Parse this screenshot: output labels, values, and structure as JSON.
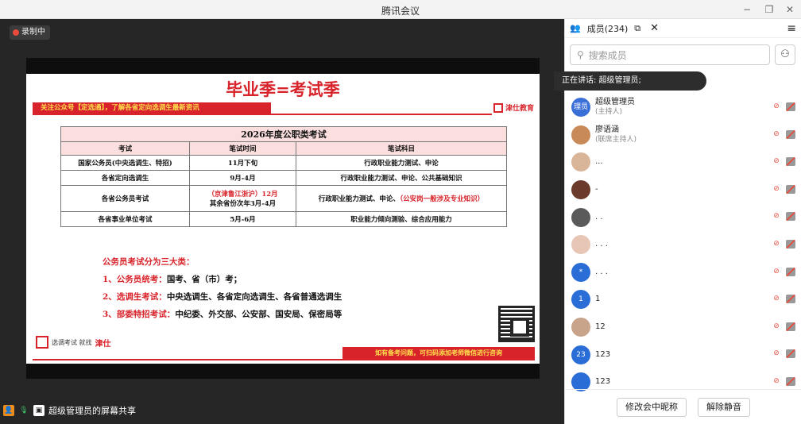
{
  "window": {
    "title": "腾讯会议",
    "min": "−",
    "restore": "❐",
    "close": "✕"
  },
  "stage": {
    "recording_label": "录制中",
    "share_label": "超级管理员的屏幕共享"
  },
  "slide": {
    "title": "毕业季=考试季",
    "banner": "关注公众号【定选通】，了解各省定向选调生最新资讯",
    "brand": "津仕教育",
    "table_caption": "2026年度公职类考试",
    "headers": [
      "考试",
      "笔试时间",
      "笔试科目"
    ],
    "rows": [
      [
        "国家公务员(中央选调生、特招)",
        "11月下旬",
        "行政职业能力测试、申论"
      ],
      [
        "各省定向选调生",
        "9月-4月",
        "行政职业能力测试、申论、公共基础知识"
      ],
      [
        "各省公务员考试",
        "（京津鲁江浙沪）12月",
        "其余省份次年3月-4月",
        "行政职业能力测试、申论、",
        "（公安岗一般涉及专业知识）"
      ],
      [
        "各省事业单位考试",
        "5月-6月",
        "职业能力倾向测验、综合应用能力"
      ]
    ],
    "categories_title": "公务员考试分为三大类：",
    "categories": [
      {
        "head": "1、公务员统考：",
        "body": "国考、省（市）考；"
      },
      {
        "head": "2、选调生考试：",
        "body": "中央选调生、各省定向选调生、各省普通选调生"
      },
      {
        "head": "3、部委特招考试：",
        "body": "中纪委、外交部、公安部、国安局、保密局等"
      }
    ],
    "footer_note": "如有备考问题，可扫码添加老师微信进行咨询",
    "footer_logo_text": "选调考试 就找",
    "footer_brand": "津仕"
  },
  "panel": {
    "tab_label": "成员(234)",
    "search_placeholder": "搜索成员",
    "speaking": "正在讲话: 超级管理员;",
    "members": [
      {
        "name": "超级管理员",
        "role": "(主持人)",
        "avatar": "理员",
        "color": "#3b6fd8"
      },
      {
        "name": "廖语涵",
        "role": "(联席主持人)",
        "avatar": "",
        "color": "#c98a5a"
      },
      {
        "name": "...",
        "role": "",
        "avatar": "",
        "color": "#d9b59a"
      },
      {
        "name": "-",
        "role": "",
        "avatar": "",
        "color": "#6b3a2a"
      },
      {
        "name": ". .",
        "role": "",
        "avatar": "",
        "color": "#5a5a5a"
      },
      {
        "name": ". . .",
        "role": "",
        "avatar": "",
        "color": "#e8c6b6"
      },
      {
        "name": ". . .",
        "role": "",
        "avatar": "*",
        "color": "#2a6dd6"
      },
      {
        "name": "1",
        "role": "",
        "avatar": "1",
        "color": "#2a6dd6"
      },
      {
        "name": "12",
        "role": "",
        "avatar": "",
        "color": "#c8a58a"
      },
      {
        "name": "123",
        "role": "",
        "avatar": "23",
        "color": "#2a6dd6"
      },
      {
        "name": "123",
        "role": "",
        "avatar": "",
        "color": "#2a6dd6"
      }
    ],
    "rename_button": "修改会中昵称",
    "unmute_button": "解除静音"
  }
}
